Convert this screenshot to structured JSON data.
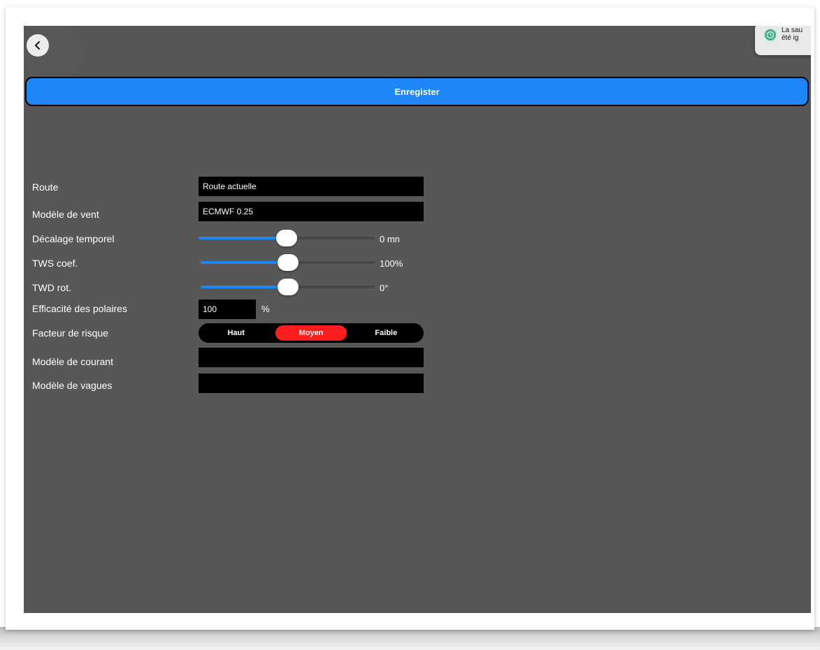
{
  "toolbar": {
    "save_label": "Enregister"
  },
  "toast": {
    "text": "La sau\nété ig",
    "icon": "clock-icon"
  },
  "form": {
    "route": {
      "label": "Route",
      "value": "Route actuelle"
    },
    "wind_model": {
      "label": "Modèle de vent",
      "value": "ECMWF 0.25"
    },
    "time_offset": {
      "label": "Décalage temporel",
      "value_text": "0 mn",
      "level": 0.5
    },
    "tws_coef": {
      "label": "TWS coef.",
      "value_text": "100%",
      "level": 0.5
    },
    "twd_rot": {
      "label": "TWD rot.",
      "value_text": "0°",
      "level": 0.5
    },
    "polar_efficiency": {
      "label": "Efficacité des polaires",
      "value": "100",
      "unit": "%"
    },
    "risk_factor": {
      "label": "Facteur de risque",
      "options": [
        "Haut",
        "Moyen",
        "Faible"
      ],
      "selected": "Moyen"
    },
    "current_model": {
      "label": "Modèle de courant",
      "value": ""
    },
    "wave_model": {
      "label": "Modèle de vagues",
      "value": ""
    }
  },
  "colors": {
    "accent": "#1e86f8",
    "selected_segment": "#ff1e1e",
    "background": "#575757"
  }
}
